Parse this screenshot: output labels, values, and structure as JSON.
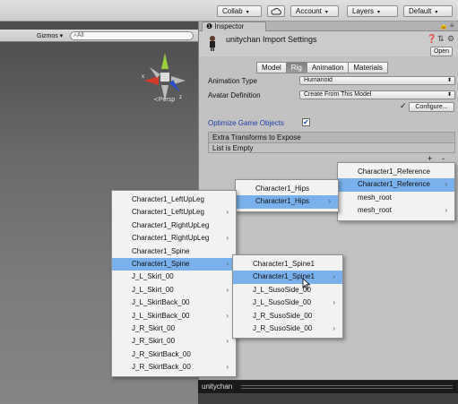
{
  "toolbar": {
    "collab_label": "Collab",
    "cloud_icon": "cloud-icon",
    "account_label": "Account",
    "layers_label": "Layers",
    "layout_label": "Default"
  },
  "scene": {
    "gizmos_label": "Gizmos",
    "search_placeholder": "All",
    "persp_label": "Persp"
  },
  "inspector": {
    "tab_label": "Inspector",
    "title": "unitychan Import Settings",
    "open_label": "Open",
    "tabs": [
      "Model",
      "Rig",
      "Animation",
      "Materials"
    ],
    "selected_tab": "Rig",
    "animation_type_label": "Animation Type",
    "animation_type_value": "Humanoid",
    "avatar_definition_label": "Avatar Definition",
    "avatar_definition_value": "Create From This Model",
    "configure_label": "Configure...",
    "optimize_label": "Optimize Game Objects",
    "optimize_checked": true,
    "extra_transforms_label": "Extra Transforms to Expose",
    "list_empty_label": "List is Empty",
    "plus_label": "+",
    "minus_label": "-"
  },
  "preview": {
    "title": "unitychan"
  },
  "menus": {
    "main": [
      {
        "label": "Character1_LeftUpLeg",
        "submenu": false,
        "selected": false
      },
      {
        "label": "Character1_LeftUpLeg",
        "submenu": true,
        "selected": false
      },
      {
        "label": "Character1_RightUpLeg",
        "submenu": false,
        "selected": false
      },
      {
        "label": "Character1_RightUpLeg",
        "submenu": true,
        "selected": false
      },
      {
        "label": "Character1_Spine",
        "submenu": false,
        "selected": false
      },
      {
        "label": "Character1_Spine",
        "submenu": true,
        "selected": true
      },
      {
        "label": "J_L_Skirt_00",
        "submenu": false,
        "selected": false
      },
      {
        "label": "J_L_Skirt_00",
        "submenu": true,
        "selected": false
      },
      {
        "label": "J_L_SkirtBack_00",
        "submenu": false,
        "selected": false
      },
      {
        "label": "J_L_SkirtBack_00",
        "submenu": true,
        "selected": false
      },
      {
        "label": "J_R_Skirt_00",
        "submenu": false,
        "selected": false
      },
      {
        "label": "J_R_Skirt_00",
        "submenu": true,
        "selected": false
      },
      {
        "label": "J_R_SkirtBack_00",
        "submenu": false,
        "selected": false
      },
      {
        "label": "J_R_SkirtBack_00",
        "submenu": true,
        "selected": false
      }
    ],
    "hips": [
      {
        "label": "Character1_Hips",
        "submenu": false,
        "selected": false
      },
      {
        "label": "Character1_Hips",
        "submenu": true,
        "selected": true
      }
    ],
    "reference": [
      {
        "label": "Character1_Reference",
        "submenu": false,
        "selected": false
      },
      {
        "label": "Character1_Reference",
        "submenu": true,
        "selected": true
      },
      {
        "label": "mesh_root",
        "submenu": false,
        "selected": false
      },
      {
        "label": "mesh_root",
        "submenu": true,
        "selected": false
      }
    ],
    "spine1": [
      {
        "label": "Character1_Spine1",
        "submenu": false,
        "selected": false
      },
      {
        "label": "Character1_Spine1",
        "submenu": true,
        "selected": true
      },
      {
        "label": "J_L_SusoSide_00",
        "submenu": false,
        "selected": false
      },
      {
        "label": "J_L_SusoSide_00",
        "submenu": true,
        "selected": false
      },
      {
        "label": "J_R_SusoSide_00",
        "submenu": false,
        "selected": false
      },
      {
        "label": "J_R_SusoSide_00",
        "submenu": true,
        "selected": false
      }
    ]
  }
}
